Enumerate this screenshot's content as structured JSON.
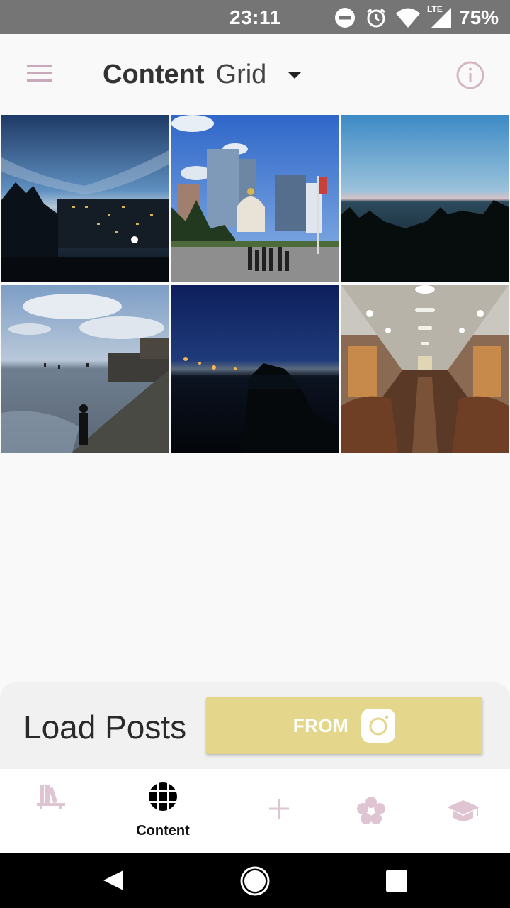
{
  "status_bar": {
    "time": "23:11",
    "network": "LTE",
    "battery": "75%",
    "icons": [
      "do-not-disturb-icon",
      "alarm-icon",
      "wifi-icon",
      "signal-icon",
      "battery-icon"
    ]
  },
  "app_bar": {
    "title_bold": "Content",
    "title_light": "Grid",
    "menu_icon": "hamburger-menu-icon",
    "dropdown_icon": "caret-down-icon",
    "info_icon": "info-icon"
  },
  "grid": {
    "photos": [
      {
        "subject": "evening sky over buildings"
      },
      {
        "subject": "city towers and chapel with people"
      },
      {
        "subject": "sea horizon at dusk"
      },
      {
        "subject": "sea shore with fisherman"
      },
      {
        "subject": "night shore lights"
      },
      {
        "subject": "metro train interior"
      }
    ]
  },
  "load_posts": {
    "label": "Load Posts",
    "button_text": "FROM",
    "button_icon": "instagram-icon"
  },
  "bottom_nav": {
    "items": [
      {
        "icon": "library-icon",
        "label": ""
      },
      {
        "icon": "grid-icon",
        "label": "Content"
      },
      {
        "icon": "plus-icon",
        "label": ""
      },
      {
        "icon": "flower-icon",
        "label": ""
      },
      {
        "icon": "graduation-cap-icon",
        "label": ""
      }
    ]
  },
  "colors": {
    "accent_pink": "#d8bcc8",
    "button_yellow": "#e4d68a",
    "status_bar": "#757575"
  }
}
